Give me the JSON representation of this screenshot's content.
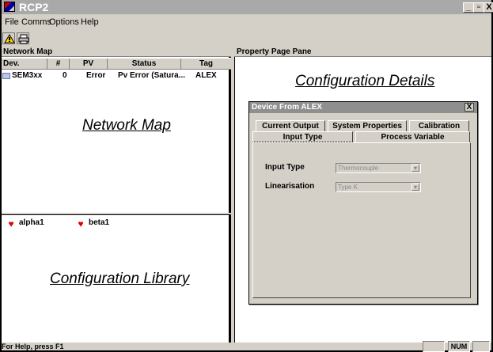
{
  "app": {
    "title": "RCP2",
    "window_buttons": [
      "_",
      "▫",
      "X"
    ]
  },
  "menu": {
    "items": [
      {
        "label": "File",
        "underline": "F"
      },
      {
        "label": "Comms",
        "underline": "C"
      },
      {
        "label": "Options",
        "underline": "O"
      },
      {
        "label": "Help",
        "underline": "H"
      }
    ]
  },
  "toolbar": {
    "buttons": [
      {
        "name": "alert-icon"
      },
      {
        "name": "printer-icon"
      }
    ]
  },
  "network_map": {
    "header": "Network Map",
    "columns": [
      "Dev.",
      "#",
      "PV",
      "Status",
      "Tag"
    ],
    "rows": [
      {
        "dev": "SEM3xx",
        "number": "0",
        "pv": "Error",
        "status": "Pv Error (Satura...",
        "tag": "ALEX"
      }
    ],
    "overlay_label": "Network Map"
  },
  "configuration_library": {
    "items": [
      "alpha1",
      "beta1"
    ],
    "overlay_label": "Configuration Library"
  },
  "property_pane": {
    "header": "Property Page Pane",
    "overlay_label": "Configuration Details",
    "dialog": {
      "title": "Device From ALEX",
      "close": "X",
      "tabs_row1": [
        "Current Output",
        "System Properties",
        "Calibration"
      ],
      "tabs_row2": [
        "Input Type",
        "Process Variable"
      ],
      "active_tab": "Input Type",
      "fields": [
        {
          "label": "Input Type",
          "value": "Thermocouple"
        },
        {
          "label": "Linearisation",
          "value": "Type K"
        }
      ]
    }
  },
  "status_bar": {
    "help_text": "For Help, press F1",
    "indicator": "NUM"
  },
  "colors": {
    "title_bar": "#a9a9a9",
    "dialog_title": "#8f8f8f",
    "heart": "#dd0000",
    "panel_bg": "#d4d0c8"
  }
}
